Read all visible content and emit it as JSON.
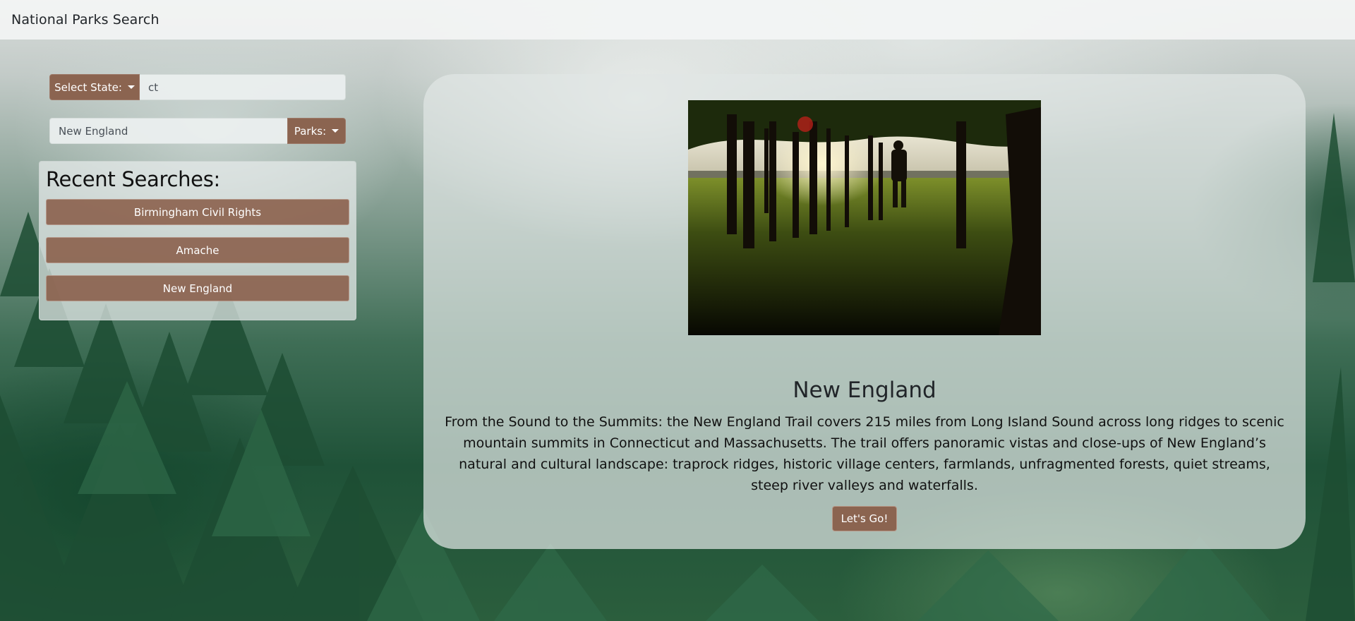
{
  "navbar": {
    "brand": "National Parks Search"
  },
  "search": {
    "state_dropdown_label": "Select State:",
    "state_input_value": "ct",
    "park_input_value": "New England",
    "parks_dropdown_label": "Parks:"
  },
  "recent": {
    "title": "Recent Searches:",
    "items": [
      {
        "label": "Birmingham Civil Rights"
      },
      {
        "label": "Amache"
      },
      {
        "label": "New England"
      }
    ]
  },
  "park": {
    "image_alt": "Hiker walking through sunlit trees on a grassy ridge",
    "name": "New England",
    "description": "From the Sound to the Summits: the New England Trail covers 215 miles from Long Island Sound across long ridges to scenic mountain summits in Connecticut and Massachusetts. The trail offers panoramic vistas and close-ups of New England’s natural and cultural landscape: traprock ridges, historic village centers, farmlands, unfragmented forests, quiet streams, steep river valleys and waterfalls.",
    "cta_label": "Let's Go!"
  },
  "colors": {
    "button_brown": "#8b6450",
    "text_dark": "#212529"
  }
}
